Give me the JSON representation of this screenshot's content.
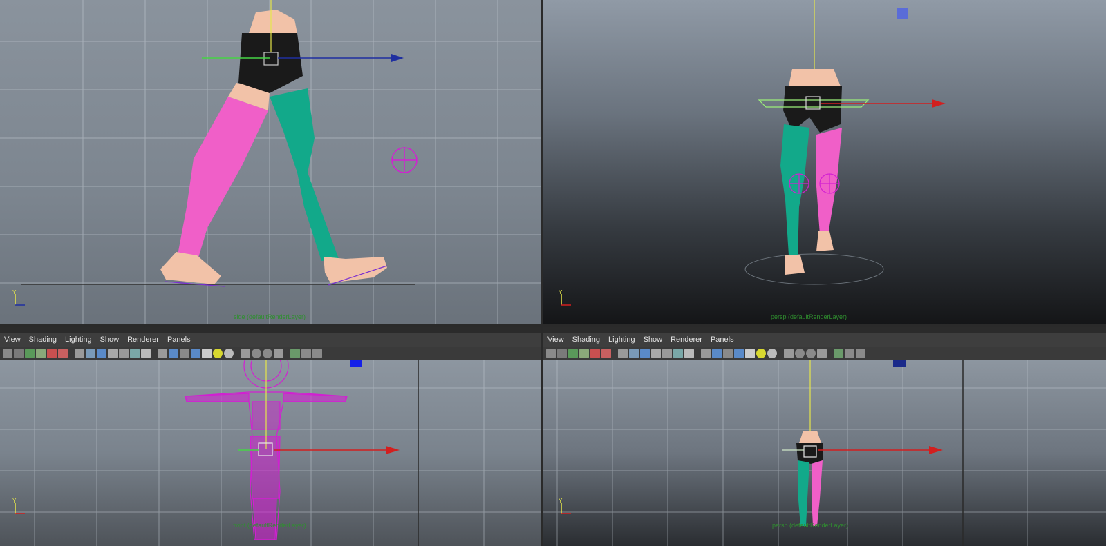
{
  "viewports": {
    "top_left": {
      "camera_label": "side (defaultRenderLayer)"
    },
    "top_right": {
      "camera_label": "persp (defaultRenderLayer)"
    },
    "bottom_left": {
      "camera_label": "front (defaultRenderLayer)"
    },
    "bottom_right": {
      "camera_label": "persp (defaultRenderLayer)"
    }
  },
  "panel_menus": {
    "left": [
      "View",
      "Shading",
      "Lighting",
      "Show",
      "Renderer",
      "Panels"
    ],
    "right": [
      "View",
      "Shading",
      "Lighting",
      "Show",
      "Renderer",
      "Panels"
    ]
  },
  "toolbar_icons": [
    "camera-icon",
    "camera-attributes-icon",
    "bookmark-icon",
    "image-plane-icon",
    "grease-pencil-icon",
    "two-d-pan-icon",
    "grid-icon",
    "film-gate-icon",
    "resolution-gate-icon",
    "gate-mask-icon",
    "field-chart-icon",
    "safe-action-icon",
    "safe-title-icon",
    "wireframe-icon",
    "smooth-shade-icon",
    "default-material-icon",
    "textured-icon",
    "use-lights-icon",
    "shadows-icon",
    "screen-space-ao-icon",
    "motion-blur-icon",
    "anti-alias-icon",
    "depth-of-field-icon",
    "isolate-select-icon",
    "xray-icon",
    "xray-joints-icon",
    "xray-components-icon"
  ],
  "colors": {
    "pink_leg": "#f05fc8",
    "teal_leg": "#12a98a",
    "shorts": "#1a1a1a",
    "skin": "#f2c2a8",
    "rig_magenta": "#d21fd2",
    "x_axis": "#d21f1f",
    "y_axis": "#e6e64a",
    "z_axis": "#1f2fa0",
    "grid": "#c8d0d8"
  }
}
